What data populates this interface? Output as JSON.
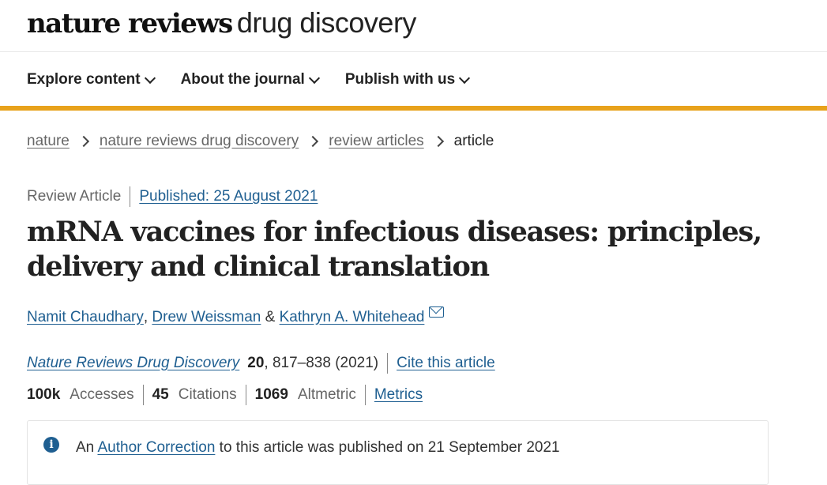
{
  "header": {
    "brand_bold": "nature reviews",
    "brand_light": "drug discovery"
  },
  "nav": {
    "items": [
      {
        "label": "Explore content"
      },
      {
        "label": "About the journal"
      },
      {
        "label": "Publish with us"
      }
    ]
  },
  "colors": {
    "accent_bar": "#e8a21b",
    "link": "#1f5f91"
  },
  "breadcrumb": {
    "items": [
      "nature",
      "nature reviews drug discovery",
      "review articles"
    ],
    "current": "article"
  },
  "article": {
    "type": "Review Article",
    "published": "Published: 25 August 2021",
    "title": "mRNA vaccines for infectious diseases: principles, delivery and clinical translation",
    "authors": [
      "Namit Chaudhary",
      "Drew Weissman",
      "Kathryn A. Whitehead"
    ],
    "author_sep": ", ",
    "author_and": " & ",
    "journal": "Nature Reviews Drug Discovery",
    "volume": "20",
    "pages_year": ", 817–838 (2021)",
    "cite_label": "Cite this article"
  },
  "metrics": {
    "accesses_value": "100k",
    "accesses_label": "Accesses",
    "citations_value": "45",
    "citations_label": "Citations",
    "altmetric_value": "1069",
    "altmetric_label": "Altmetric",
    "metrics_link": "Metrics"
  },
  "notice": {
    "prefix": "An ",
    "link": "Author Correction",
    "suffix": " to this article was published on 21 September 2021",
    "icon": "info-icon"
  }
}
